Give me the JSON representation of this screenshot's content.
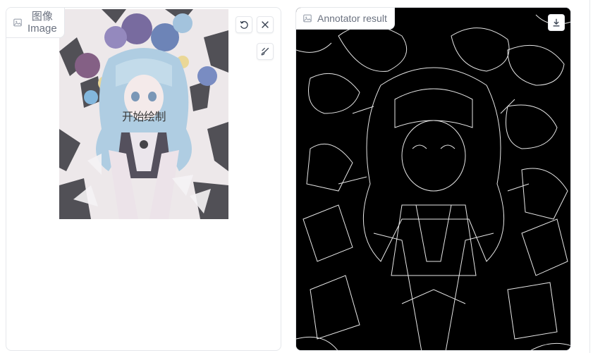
{
  "input": {
    "label_zh": "图像",
    "label_en": "Image",
    "hint": "开始绘制",
    "icon": "image-icon",
    "buttons": {
      "undo": "undo-icon",
      "close": "close-icon",
      "brush": "brush-icon"
    }
  },
  "output": {
    "label": "Annotator result",
    "icon": "image-icon",
    "buttons": {
      "download": "download-icon"
    }
  },
  "colors": {
    "border": "#e5e7eb",
    "label_text": "#6b7280",
    "result_bg": "#000000"
  }
}
